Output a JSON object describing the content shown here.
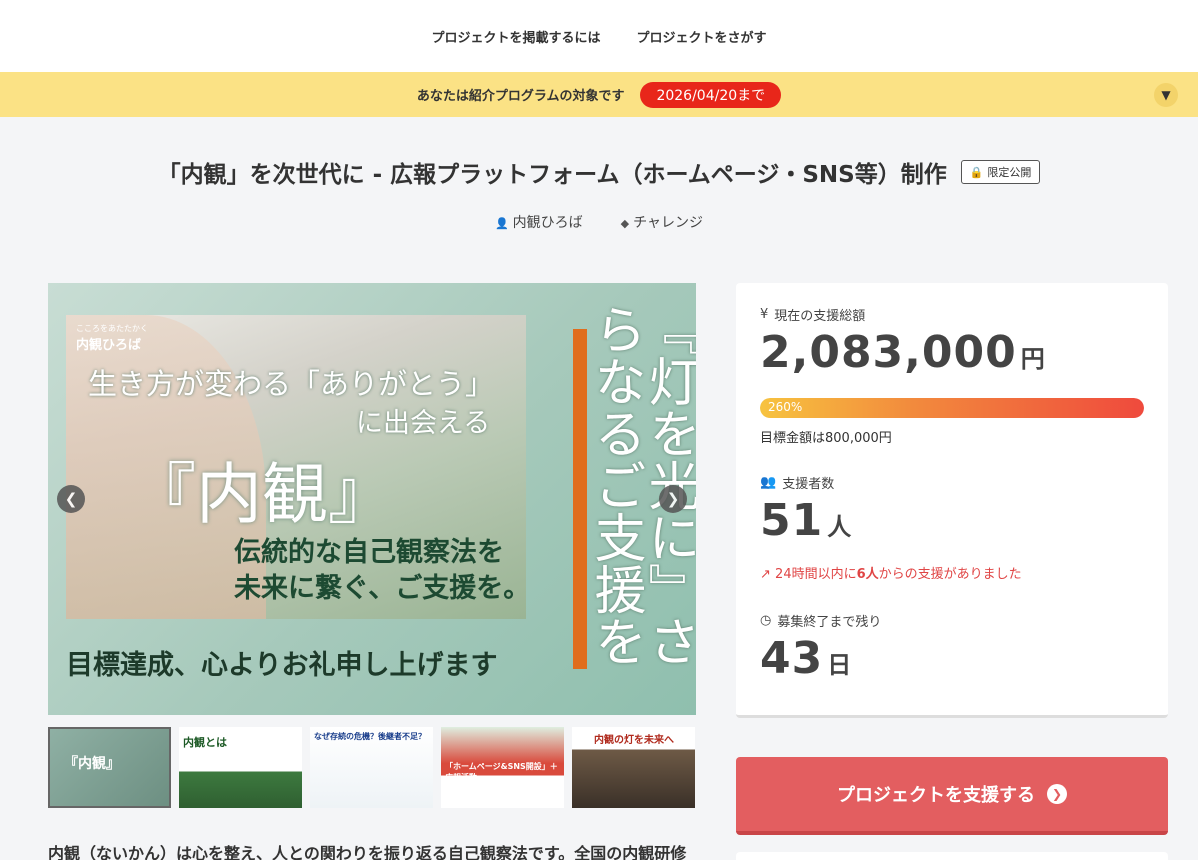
{
  "nav": {
    "post_project": "プロジェクトを掲載するには",
    "find_project": "プロジェクトをさがす"
  },
  "referral": {
    "text": "あなたは紹介プログラムの対象です",
    "deadline": "2026/04/20まで",
    "toggle_icon": "chevron-down-icon"
  },
  "project": {
    "title": "「内観」を次世代に - 広報プラットフォーム（ホームページ・SNS等）制作",
    "badge": "限定公開",
    "owner": "内観ひろば",
    "category": "チャレンジ"
  },
  "hero": {
    "logo_top": "こころをあたたかく",
    "logo": "内観ひろば",
    "line1": "生き方が変わる「ありがとう」",
    "line2": "に出会える",
    "big": "『内観』",
    "sub1": "伝統的な自己観察法を",
    "sub2": "未来に繋ぐ、ご支援を。",
    "bottom": "目標達成、心よりお礼申し上げます",
    "vertical": "『灯を光に』さらなるご支援を"
  },
  "thumbnails": [
    {
      "text": "『内観』"
    },
    {
      "text": "内観とは"
    },
    {
      "text": "なぜ存続の危機？後継者不足？"
    },
    {
      "text": "「ホームページ&SNS開設」＋広報活動"
    },
    {
      "text": "内観の灯を未来へ"
    }
  ],
  "stats": {
    "total_label": "現在の支援総額",
    "total_amount": "2,083,000",
    "total_unit": "円",
    "percent_label": "260%",
    "percent": 260,
    "goal_text": "目標金額は800,000円",
    "backers_label": "支援者数",
    "backers": "51",
    "backers_unit": "人",
    "trend_prefix": "24時間以内に",
    "trend_count": "6人",
    "trend_suffix": "からの支援がありました",
    "remaining_label": "募集終了まで残り",
    "remaining": "43",
    "remaining_unit": "日"
  },
  "support_button": "プロジェクトを支援する",
  "description": "内観（ないかん）は心を整え、人との関わりを振り返る自己観察法です。全国の内観研修",
  "colors": {
    "accent": "#e35e60",
    "banner": "#fbe285",
    "deadline": "#e8261a",
    "trend": "#e04545"
  }
}
